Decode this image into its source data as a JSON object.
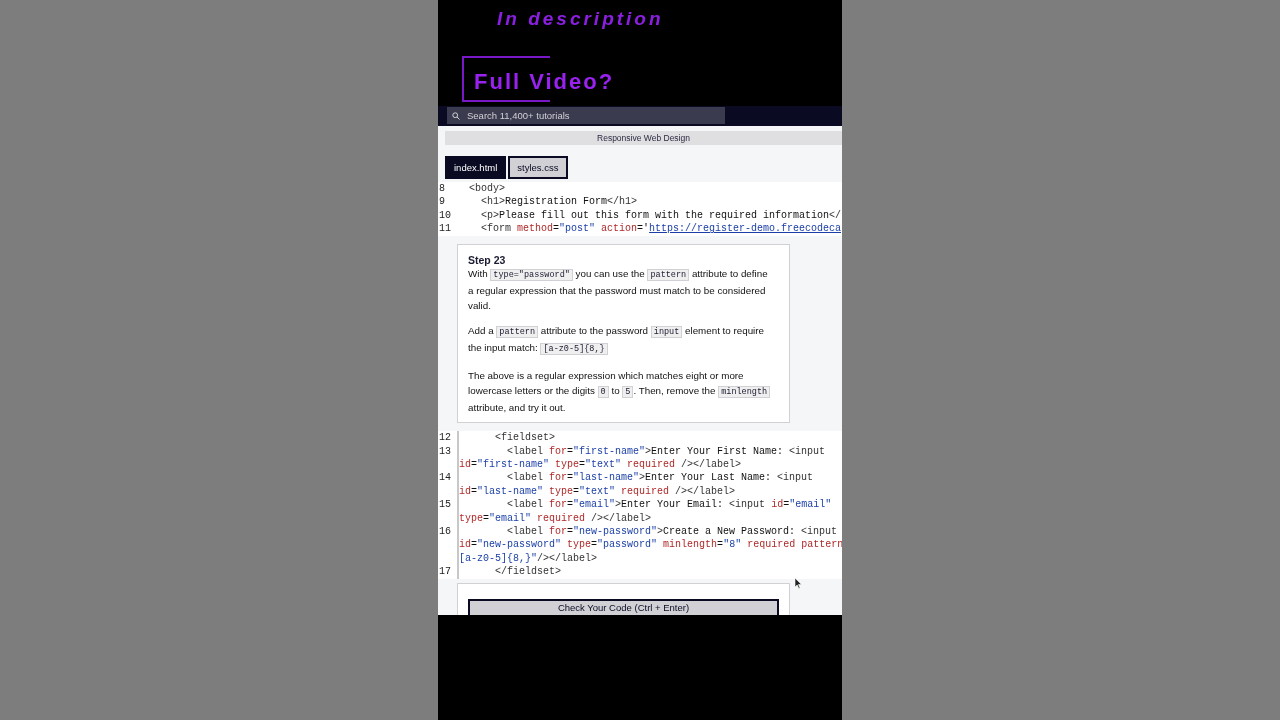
{
  "promo": {
    "line_1": "In description",
    "line_2": "Full Video?"
  },
  "search": {
    "placeholder": "Search 11,400+ tutorials"
  },
  "breadcrumb": "Responsive Web Design",
  "tabs": [
    {
      "label": "index.html",
      "selected": true
    },
    {
      "label": "styles.css",
      "selected": false
    }
  ],
  "editor_top": [
    {
      "number": "8",
      "wrapped_parts": [
        {
          "tokens": [
            {
              "kind": "tag",
              "text": "  <body>"
            }
          ]
        }
      ]
    },
    {
      "number": "9",
      "wrapped_parts": [
        {
          "tokens": [
            {
              "kind": "tag",
              "text": "    <h1>"
            },
            {
              "kind": "text",
              "text": "Registration Form"
            },
            {
              "kind": "tag",
              "text": "</h1>"
            }
          ]
        }
      ]
    },
    {
      "number": "10",
      "wrapped_parts": [
        {
          "tokens": [
            {
              "kind": "tag",
              "text": "    <p>"
            },
            {
              "kind": "text",
              "text": "Please fill out this form with the required information"
            },
            {
              "kind": "tag",
              "text": "</"
            }
          ]
        }
      ]
    },
    {
      "number": "11",
      "wrapped_parts": [
        {
          "tokens": [
            {
              "kind": "tag",
              "text": "    <form "
            },
            {
              "kind": "attr",
              "text": "method"
            },
            {
              "kind": "text",
              "text": "="
            },
            {
              "kind": "string",
              "text": "\"post\" "
            },
            {
              "kind": "attr",
              "text": "action"
            },
            {
              "kind": "text",
              "text": "='"
            },
            {
              "kind": "link",
              "text": "https://register-demo.freecodeca"
            }
          ]
        }
      ]
    }
  ],
  "step": {
    "title": "Step 23",
    "paragraphs": [
      [
        {
          "kind": "text",
          "text": "With "
        },
        {
          "kind": "code",
          "text": "type=\"password\""
        },
        {
          "kind": "text",
          "text": " you can use the "
        },
        {
          "kind": "code",
          "text": "pattern"
        },
        {
          "kind": "text",
          "text": " attribute to define a regular expression that the password must match to be considered valid."
        }
      ],
      [
        {
          "kind": "text",
          "text": "Add a "
        },
        {
          "kind": "code",
          "text": "pattern"
        },
        {
          "kind": "text",
          "text": " attribute to the password "
        },
        {
          "kind": "code",
          "text": "input"
        },
        {
          "kind": "text",
          "text": " element to require the input match: "
        },
        {
          "kind": "code",
          "text": "[a-z0-5]{8,}"
        }
      ],
      [
        {
          "kind": "text",
          "text": "The above is a regular expression which matches eight or more lowercase letters or the digits "
        },
        {
          "kind": "code",
          "text": "0"
        },
        {
          "kind": "text",
          "text": " to "
        },
        {
          "kind": "code",
          "text": "5"
        },
        {
          "kind": "text",
          "text": ". Then, remove the "
        },
        {
          "kind": "code",
          "text": "minlength"
        },
        {
          "kind": "text",
          "text": " attribute, and try it out."
        }
      ]
    ]
  },
  "editor_bottom": [
    {
      "number": "12",
      "wrapped_parts": [
        {
          "tokens": [
            {
              "kind": "tag",
              "text": "      <fieldset>"
            }
          ]
        }
      ]
    },
    {
      "number": "13",
      "wrapped_parts": [
        {
          "tokens": [
            {
              "kind": "tag",
              "text": "        <label "
            },
            {
              "kind": "attr",
              "text": "for"
            },
            {
              "kind": "text",
              "text": "="
            },
            {
              "kind": "string",
              "text": "\"first-name\""
            },
            {
              "kind": "tag",
              "text": ">"
            },
            {
              "kind": "text",
              "text": "Enter Your First Name: "
            },
            {
              "kind": "tag",
              "text": "<input"
            }
          ]
        },
        {
          "tokens": [
            {
              "kind": "attr",
              "text": "id"
            },
            {
              "kind": "text",
              "text": "="
            },
            {
              "kind": "string",
              "text": "\"first-name\" "
            },
            {
              "kind": "attr",
              "text": "type"
            },
            {
              "kind": "text",
              "text": "="
            },
            {
              "kind": "string",
              "text": "\"text\" "
            },
            {
              "kind": "attr",
              "text": "required"
            },
            {
              "kind": "tag",
              "text": " /></label>"
            }
          ]
        }
      ]
    },
    {
      "number": "14",
      "wrapped_parts": [
        {
          "tokens": [
            {
              "kind": "tag",
              "text": "        <label "
            },
            {
              "kind": "attr",
              "text": "for"
            },
            {
              "kind": "text",
              "text": "="
            },
            {
              "kind": "string",
              "text": "\"last-name\""
            },
            {
              "kind": "tag",
              "text": ">"
            },
            {
              "kind": "text",
              "text": "Enter Your Last Name: "
            },
            {
              "kind": "tag",
              "text": "<input"
            }
          ]
        },
        {
          "tokens": [
            {
              "kind": "attr",
              "text": "id"
            },
            {
              "kind": "text",
              "text": "="
            },
            {
              "kind": "string",
              "text": "\"last-name\" "
            },
            {
              "kind": "attr",
              "text": "type"
            },
            {
              "kind": "text",
              "text": "="
            },
            {
              "kind": "string",
              "text": "\"text\" "
            },
            {
              "kind": "attr",
              "text": "required"
            },
            {
              "kind": "tag",
              "text": " /></label>"
            }
          ]
        }
      ]
    },
    {
      "number": "15",
      "wrapped_parts": [
        {
          "tokens": [
            {
              "kind": "tag",
              "text": "        <label "
            },
            {
              "kind": "attr",
              "text": "for"
            },
            {
              "kind": "text",
              "text": "="
            },
            {
              "kind": "string",
              "text": "\"email\""
            },
            {
              "kind": "tag",
              "text": ">"
            },
            {
              "kind": "text",
              "text": "Enter Your Email: "
            },
            {
              "kind": "tag",
              "text": "<input "
            },
            {
              "kind": "attr",
              "text": "id"
            },
            {
              "kind": "text",
              "text": "="
            },
            {
              "kind": "string",
              "text": "\"email\""
            }
          ]
        },
        {
          "tokens": [
            {
              "kind": "attr",
              "text": "type"
            },
            {
              "kind": "text",
              "text": "="
            },
            {
              "kind": "string",
              "text": "\"email\" "
            },
            {
              "kind": "attr",
              "text": "required"
            },
            {
              "kind": "tag",
              "text": " /></label>"
            }
          ]
        }
      ]
    },
    {
      "number": "16",
      "wrapped_parts": [
        {
          "tokens": [
            {
              "kind": "tag",
              "text": "        <label "
            },
            {
              "kind": "attr",
              "text": "for"
            },
            {
              "kind": "text",
              "text": "="
            },
            {
              "kind": "string",
              "text": "\"new-password\""
            },
            {
              "kind": "tag",
              "text": ">"
            },
            {
              "kind": "text",
              "text": "Create a New Password: "
            },
            {
              "kind": "tag",
              "text": "<input"
            }
          ]
        },
        {
          "tokens": [
            {
              "kind": "attr",
              "text": "id"
            },
            {
              "kind": "text",
              "text": "="
            },
            {
              "kind": "string",
              "text": "\"new-password\" "
            },
            {
              "kind": "attr",
              "text": "type"
            },
            {
              "kind": "text",
              "text": "="
            },
            {
              "kind": "string",
              "text": "\"password\" "
            },
            {
              "kind": "attr",
              "text": "minlength"
            },
            {
              "kind": "text",
              "text": "="
            },
            {
              "kind": "string",
              "text": "\"8\" "
            },
            {
              "kind": "attr",
              "text": "required pattern"
            }
          ]
        },
        {
          "tokens": [
            {
              "kind": "string",
              "text": "[a-z0-5]{8,}\""
            },
            {
              "kind": "tag",
              "text": "/></label>"
            }
          ]
        }
      ]
    },
    {
      "number": "17",
      "wrapped_parts": [
        {
          "tokens": [
            {
              "kind": "tag",
              "text": "      </fieldset>"
            }
          ]
        }
      ]
    }
  ],
  "check_button": "Check Your Code (Ctrl + Enter)"
}
